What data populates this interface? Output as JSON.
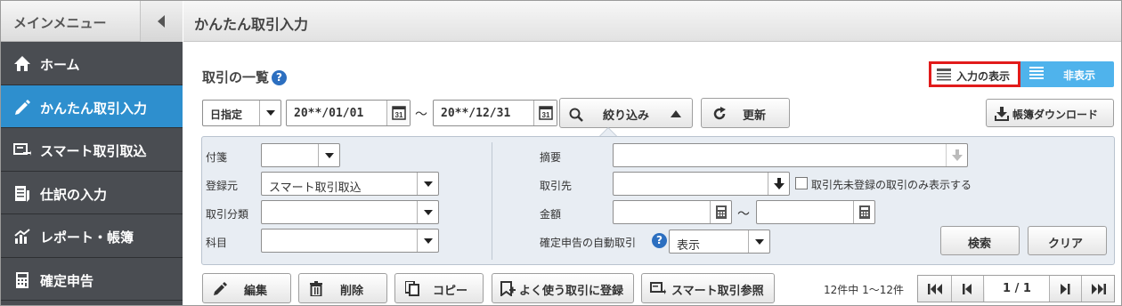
{
  "sidebar": {
    "title": "メインメニュー",
    "items": [
      {
        "label": "ホーム",
        "icon": "home-icon"
      },
      {
        "label": "かんたん取引入力",
        "icon": "pencil-icon"
      },
      {
        "label": "スマート取引取込",
        "icon": "import-icon"
      },
      {
        "label": "仕訳の入力",
        "icon": "journal-icon"
      },
      {
        "label": "レポート・帳簿",
        "icon": "chart-icon"
      },
      {
        "label": "確定申告",
        "icon": "calculator-icon"
      }
    ],
    "active_color": "#2e8fce"
  },
  "header": {
    "title": "かんたん取引入力"
  },
  "list": {
    "title": "取引の一覧",
    "toggle_show": "入力の表示",
    "toggle_hide": "非表示",
    "date_mode": "日指定",
    "date_from": "20**/01/01",
    "tilde": "～",
    "date_to": "20**/12/31",
    "filter_button": "絞り込み",
    "refresh_button": "更新",
    "download_button": "帳簿ダウンロード"
  },
  "filter": {
    "tag_label": "付箋",
    "tag_value": "",
    "source_label": "登録元",
    "source_value": "スマート取引取込",
    "category_label": "取引分類",
    "category_value": "",
    "account_label": "科目",
    "account_value": "",
    "memo_label": "摘要",
    "partner_label": "取引先",
    "partner_unregistered_label": "取引先未登録の取引のみ表示する",
    "amount_label": "金額",
    "amount_tilde": "～",
    "auto_label": "確定申告の自動取引",
    "auto_value": "表示",
    "search_button": "検索",
    "clear_button": "クリア"
  },
  "actions": {
    "edit": "編集",
    "delete": "削除",
    "copy": "コピー",
    "register_frequent": "よく使う取引に登録",
    "smart_ref": "スマート取引参照"
  },
  "pagination": {
    "count_text": "12件中 1～12件",
    "page_text": "1 / 1"
  }
}
